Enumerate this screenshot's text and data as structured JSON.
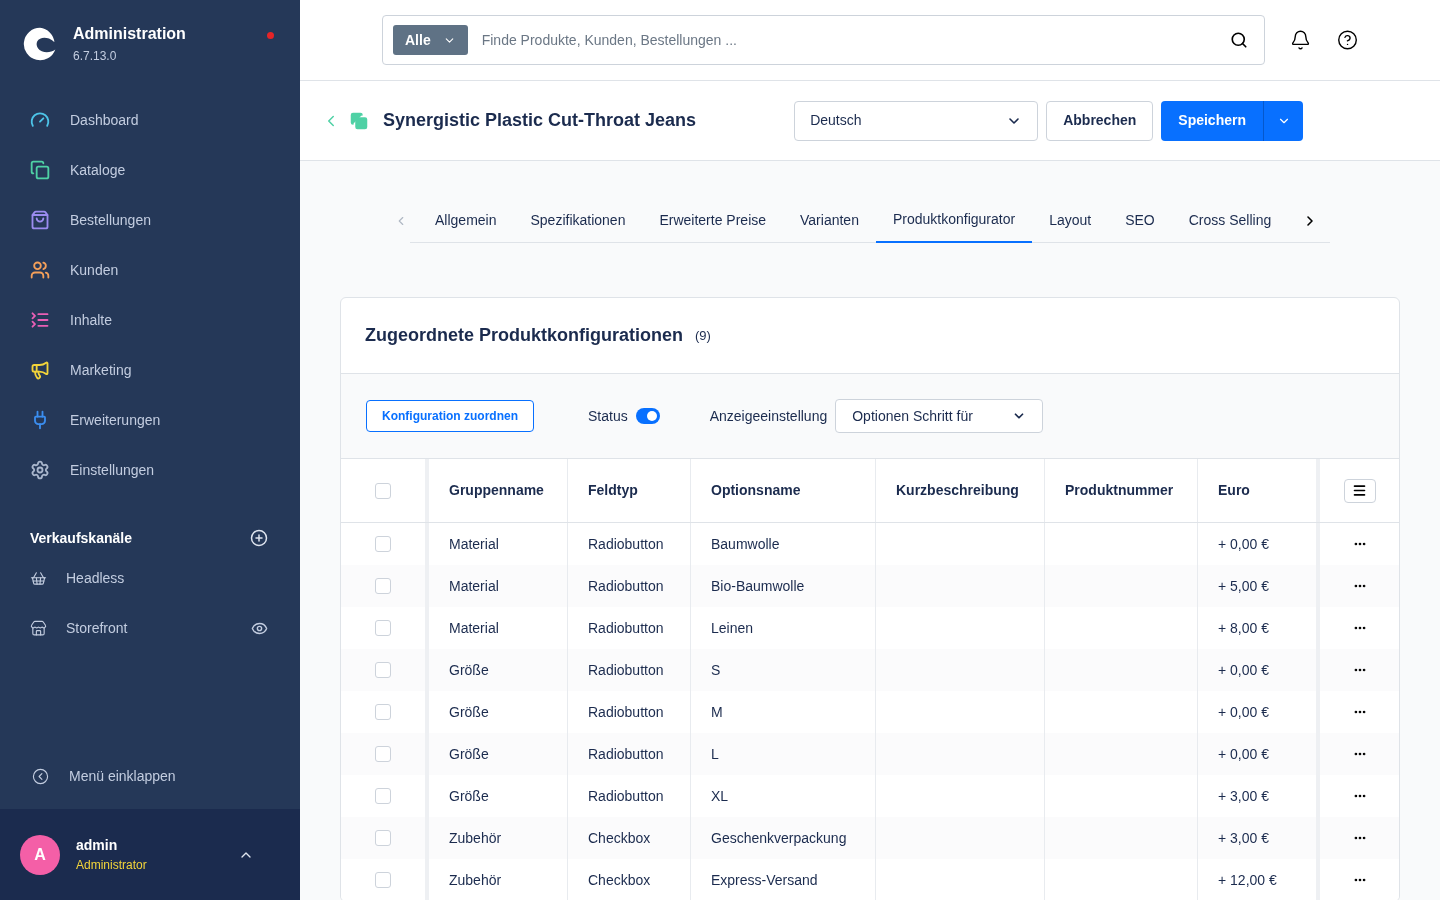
{
  "app": {
    "title": "Administration",
    "version": "6.7.13.0",
    "notification": true
  },
  "nav": [
    {
      "label": "Dashboard",
      "kind": "dashboard",
      "color": "#4dc4e8"
    },
    {
      "label": "Kataloge",
      "kind": "catalog",
      "color": "#4fd1a5"
    },
    {
      "label": "Bestellungen",
      "kind": "orders",
      "color": "#9b8cf0"
    },
    {
      "label": "Kunden",
      "kind": "customers",
      "color": "#f5a05a"
    },
    {
      "label": "Inhalte",
      "kind": "content",
      "color": "#ea5fb5"
    },
    {
      "label": "Marketing",
      "kind": "marketing",
      "color": "#f2d43a"
    },
    {
      "label": "Erweiterungen",
      "kind": "extensions",
      "color": "#3b8ef0"
    },
    {
      "label": "Einstellungen",
      "kind": "settings",
      "color": "#a9b6cc"
    }
  ],
  "sales_channels": {
    "title": "Verkaufskanäle",
    "items": [
      {
        "label": "Headless",
        "kind": "headless",
        "visible_toggle": false
      },
      {
        "label": "Storefront",
        "kind": "storefront",
        "visible_toggle": true
      }
    ]
  },
  "collapse": "Menü einklappen",
  "user": {
    "initial": "A",
    "name": "admin",
    "role": "Administrator"
  },
  "search": {
    "scope": "Alle",
    "placeholder": "Finde Produkte, Kunden, Bestellungen ..."
  },
  "product": {
    "title": "Synergistic Plastic Cut-Throat Jeans",
    "language": "Deutsch",
    "cancel": "Abbrechen",
    "save": "Speichern"
  },
  "tabs": [
    {
      "label": "Allgemein",
      "selected": false
    },
    {
      "label": "Spezifikationen",
      "selected": false
    },
    {
      "label": "Erweiterte Preise",
      "selected": false
    },
    {
      "label": "Varianten",
      "selected": false
    },
    {
      "label": "Produktkonfigurator",
      "selected": true
    },
    {
      "label": "Layout",
      "selected": false
    },
    {
      "label": "SEO",
      "selected": false
    },
    {
      "label": "Cross Selling",
      "selected": false
    }
  ],
  "card": {
    "title": "Zugeordnete Produktkonfigurationen",
    "count": "(9)",
    "assign_button": "Konfiguration zuordnen",
    "status_label": "Status",
    "status_on": true,
    "display_label": "Anzeigeeinstellung",
    "display_value": "Optionen Schritt für"
  },
  "table": {
    "all_selected": false,
    "columns": [
      "Gruppenname",
      "Feldtyp",
      "Optionsname",
      "Kurzbeschreibung",
      "Produktnummer",
      "Euro"
    ],
    "rows": [
      {
        "selected": false,
        "cells": [
          "Material",
          "Radiobutton",
          "Baumwolle",
          "",
          "",
          "+ 0,00 €"
        ]
      },
      {
        "selected": false,
        "cells": [
          "Material",
          "Radiobutton",
          "Bio-Baumwolle",
          "",
          "",
          "+ 5,00 €"
        ]
      },
      {
        "selected": false,
        "cells": [
          "Material",
          "Radiobutton",
          "Leinen",
          "",
          "",
          "+ 8,00 €"
        ]
      },
      {
        "selected": false,
        "cells": [
          "Größe",
          "Radiobutton",
          "S",
          "",
          "",
          "+ 0,00 €"
        ]
      },
      {
        "selected": false,
        "cells": [
          "Größe",
          "Radiobutton",
          "M",
          "",
          "",
          "+ 0,00 €"
        ]
      },
      {
        "selected": false,
        "cells": [
          "Größe",
          "Radiobutton",
          "L",
          "",
          "",
          "+ 0,00 €"
        ]
      },
      {
        "selected": false,
        "cells": [
          "Größe",
          "Radiobutton",
          "XL",
          "",
          "",
          "+ 3,00 €"
        ]
      },
      {
        "selected": false,
        "cells": [
          "Zubehör",
          "Checkbox",
          "Geschenkverpackung",
          "",
          "",
          "+ 3,00 €"
        ]
      },
      {
        "selected": false,
        "cells": [
          "Zubehör",
          "Checkbox",
          "Express-Versand",
          "",
          "",
          "+ 12,00 €"
        ]
      }
    ]
  }
}
